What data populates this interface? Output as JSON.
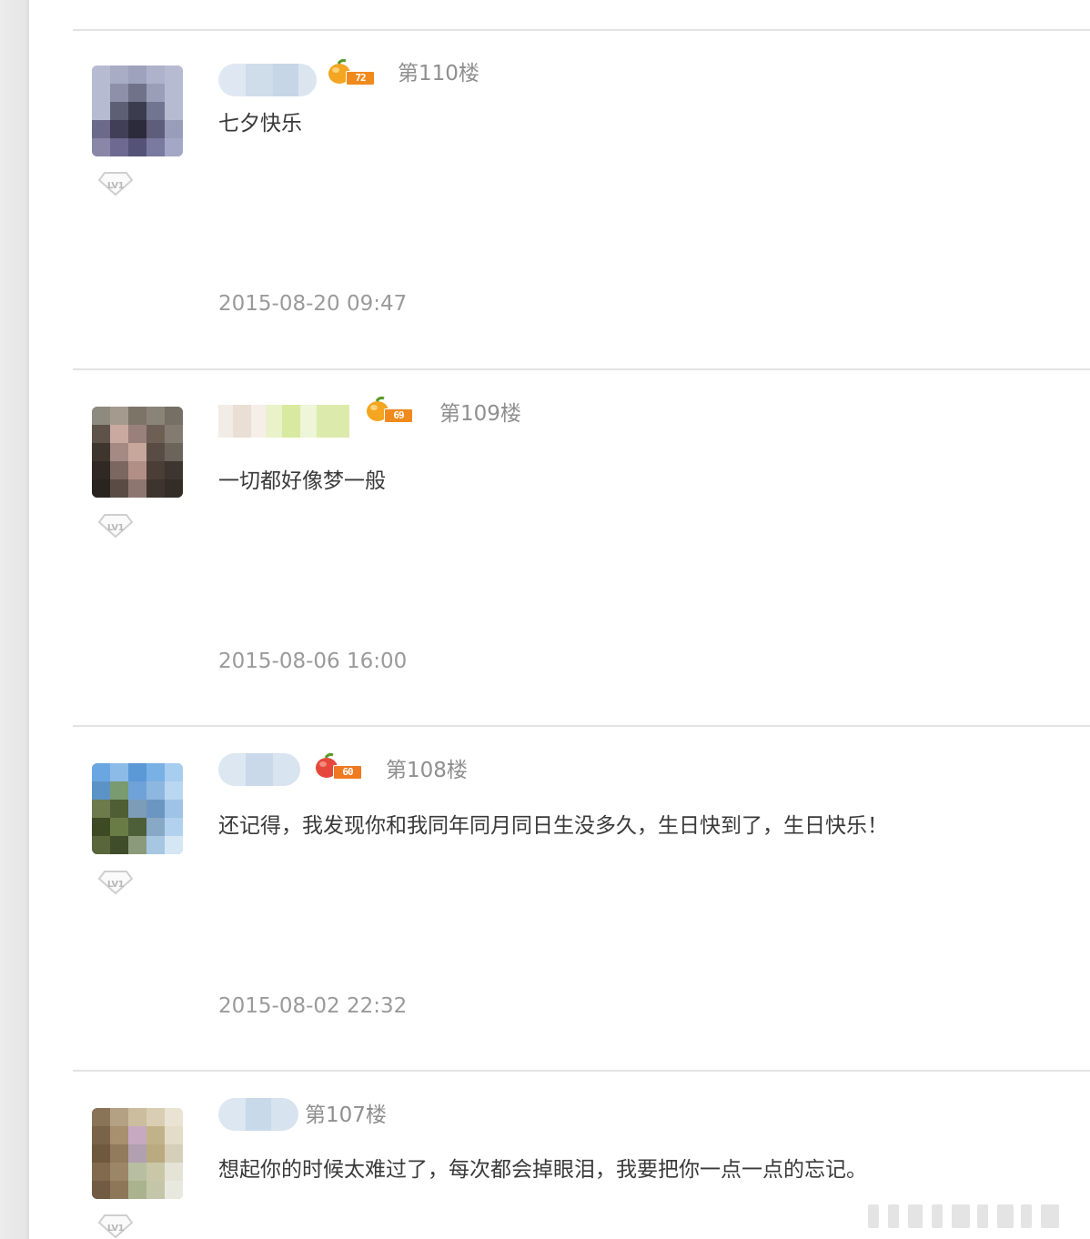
{
  "posts": [
    {
      "floor": "第110楼",
      "content": "七夕快乐",
      "time": "2015-08-20 09:47",
      "level": "72",
      "lv": "LV1"
    },
    {
      "floor": "第109楼",
      "content": "一切都好像梦一般",
      "time": "2015-08-06 16:00",
      "level": "69",
      "lv": "LV1"
    },
    {
      "floor": "第108楼",
      "content": "还记得，我发现你和我同年同月同日生没多久，生日快到了，生日快乐！",
      "time": "2015-08-02 22:32",
      "level": "60",
      "lv": "LV1"
    },
    {
      "floor": "第107楼",
      "content": "想起你的时候太难过了，每次都会掉眼泪，我要把你一点一点的忘记。",
      "lv": "LV1"
    }
  ]
}
